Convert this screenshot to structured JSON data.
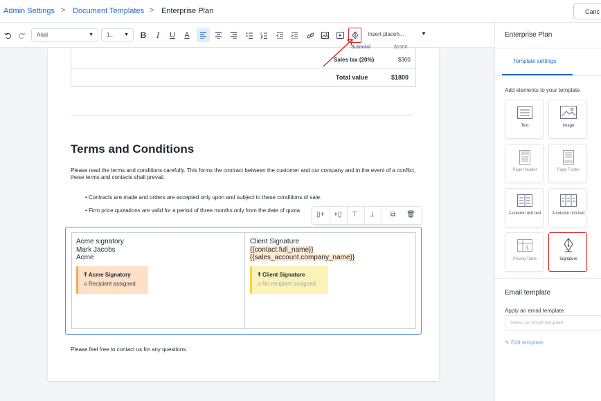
{
  "breadcrumb": {
    "admin": "Admin Settings",
    "templates": "Document Templates",
    "current": "Enterprise Plan",
    "separator": ">"
  },
  "header": {
    "cancel_label": "Canc"
  },
  "toolbar": {
    "font": "Arial",
    "size": "1...",
    "placeholder_select": "Insert placeh...",
    "icons": [
      "undo-icon",
      "redo-icon",
      "bold-icon",
      "italic-icon",
      "underline-icon",
      "text-color-icon",
      "align-left-icon",
      "align-center-icon",
      "align-right-icon",
      "bullet-list-icon",
      "numbered-list-icon",
      "outdent-icon",
      "indent-icon",
      "link-icon",
      "image-icon",
      "video-icon",
      "signature-icon"
    ],
    "labels": {
      "bold": "B",
      "italic": "I",
      "underline": "U",
      "text_color": "A"
    }
  },
  "document": {
    "summary": {
      "subtotal_label": "Subtotal",
      "subtotal_value": "$1500",
      "tax_label": "Sales tax (20%)",
      "tax_value": "$300",
      "total_label": "Total value",
      "total_value": "$1800"
    },
    "heading": "Terms and Conditions",
    "intro": "Please read the terms and conditions carefully. This forms the contract between the customer and our company and in the event of a conflict, these terms and contacts shall prevail.",
    "bullets": [
      "Contracts are made and orders are accepted only upon and subject to these conditions of sale.",
      "Firm price quotations are valid for a period of three months only from the date of quota"
    ],
    "footer_text": "Please feel free to contact us for any questions.",
    "signatures": {
      "left": {
        "title": "Acme signatory",
        "name": "Mark Jacobs",
        "company": "Acme",
        "card_title": "Acme Signatory",
        "card_status": "Recipient assigned",
        "color": "#f7a85a"
      },
      "right": {
        "title": "Client Signature",
        "placeholder1": "{{contact.full_name}}",
        "placeholder2": "{{sales_account.company_name}}",
        "card_title": "Client Signature",
        "card_status": "No recipient assigned",
        "color": "#f0d93c"
      }
    }
  },
  "panel": {
    "title": "Enterprise Plan",
    "tab": "Template settings",
    "add_elements_label": "Add elements to your template",
    "elements": [
      "Text",
      "Image",
      "Page Header",
      "Page Footer",
      "2-column rich text",
      "3-column rich text",
      "Pricing Table",
      "Signature"
    ],
    "selected_element": "Signature",
    "email_heading": "Email template",
    "email_label": "Apply an email template",
    "email_placeholder": "Select an email template",
    "edit_template": "Edit template"
  },
  "colors": {
    "accent": "#2468c8",
    "highlight": "#e02020",
    "selection": "#5a8fe0"
  }
}
